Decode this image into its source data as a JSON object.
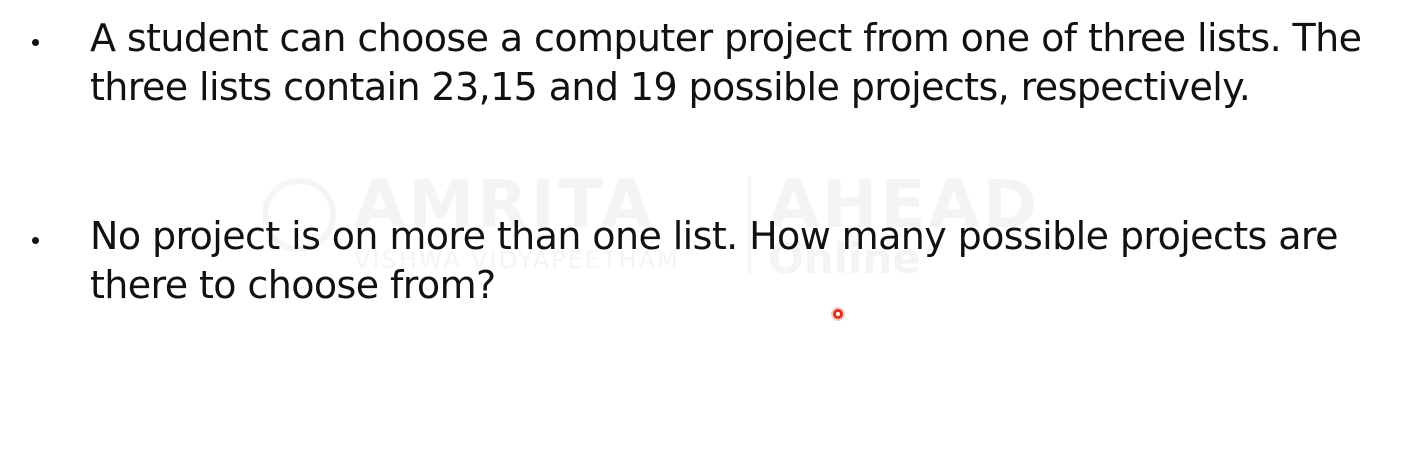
{
  "watermark": {
    "brand": "AMRITA",
    "brand2": "AHEAD",
    "subtitle": "VISHWA VIDYAPEETHAM",
    "subtitle2": "Online"
  },
  "bullets": [
    {
      "text": "A student can choose a computer project from one of three lists. The three lists contain 23,15 and 19 possible projects, respectively."
    },
    {
      "text": "No project is on more than one list. How many possible projects are there to choose from?"
    }
  ],
  "colors": {
    "text": "#111111",
    "pointer": "#e0301e",
    "background": "#ffffff"
  },
  "icons": {
    "bullet": "bullet-dot-icon",
    "pointer": "laser-pointer-icon"
  }
}
